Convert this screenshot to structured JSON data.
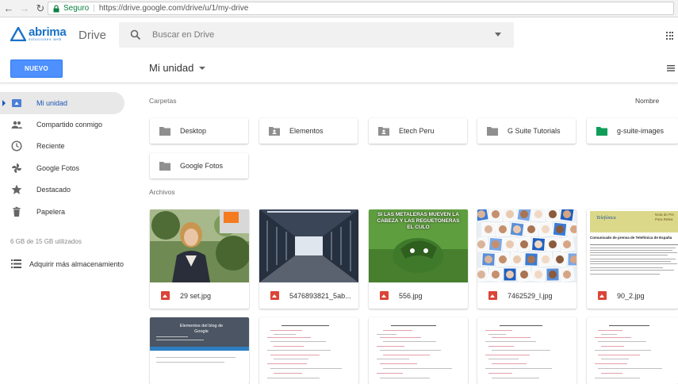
{
  "browser": {
    "secure_label": "Seguro",
    "url": "https://drive.google.com/drive/u/1/my-drive"
  },
  "header": {
    "logo_brand": "abrima",
    "logo_sub": "soluciones web",
    "product": "Drive",
    "search_placeholder": "Buscar en Drive"
  },
  "toolbar": {
    "new_label": "NUEVO",
    "location": "Mi unidad"
  },
  "sidebar": {
    "items": [
      {
        "label": "Mi unidad",
        "icon": "drive-icon"
      },
      {
        "label": "Compartido conmigo",
        "icon": "people-icon"
      },
      {
        "label": "Reciente",
        "icon": "clock-icon"
      },
      {
        "label": "Google Fotos",
        "icon": "pinwheel-icon"
      },
      {
        "label": "Destacado",
        "icon": "star-icon"
      },
      {
        "label": "Papelera",
        "icon": "trash-icon"
      }
    ],
    "storage": "6 GB de 15 GB utilizados",
    "buy_storage": "Adquirir más almacenamiento"
  },
  "main": {
    "folders_label": "Carpetas",
    "sort_label": "Nombre",
    "files_label": "Archivos",
    "folders": [
      {
        "name": "Desktop",
        "icon": "folder-icon",
        "color": "#8f8f8f"
      },
      {
        "name": "Elementos",
        "icon": "shared-folder-icon",
        "color": "#8f8f8f"
      },
      {
        "name": "Etech Peru",
        "icon": "shared-folder-icon",
        "color": "#8f8f8f"
      },
      {
        "name": "G Suite Tutorials",
        "icon": "folder-icon",
        "color": "#8f8f8f"
      },
      {
        "name": "g-suite-images",
        "icon": "folder-icon",
        "color": "#0f9d58"
      },
      {
        "name": "Google Fotos",
        "icon": "folder-icon",
        "color": "#8f8f8f"
      }
    ],
    "files": [
      {
        "name": "29 set.jpg"
      },
      {
        "name": "5476893821_5ab..."
      },
      {
        "name": "556.jpg",
        "thumb_caption": "SI LAS METALERAS MUEVEN LA CABEZA Y LAS REGUETONERAS EL CULO"
      },
      {
        "name": "7462529_l.jpg"
      },
      {
        "name": "90_2.jpg",
        "thumb_title": "Comunicado de prensa de Telefónica de España",
        "thumb_brand": "Telefónica",
        "thumb_note": "Nota de Pre Para Relea"
      }
    ],
    "doc_thumb_title": "Elementos del blog de Google"
  },
  "colors": {
    "accent": "#4d90fe",
    "active_nav": "#1a56b8",
    "green_folder": "#0f9d58",
    "image_icon": "#db4437"
  }
}
